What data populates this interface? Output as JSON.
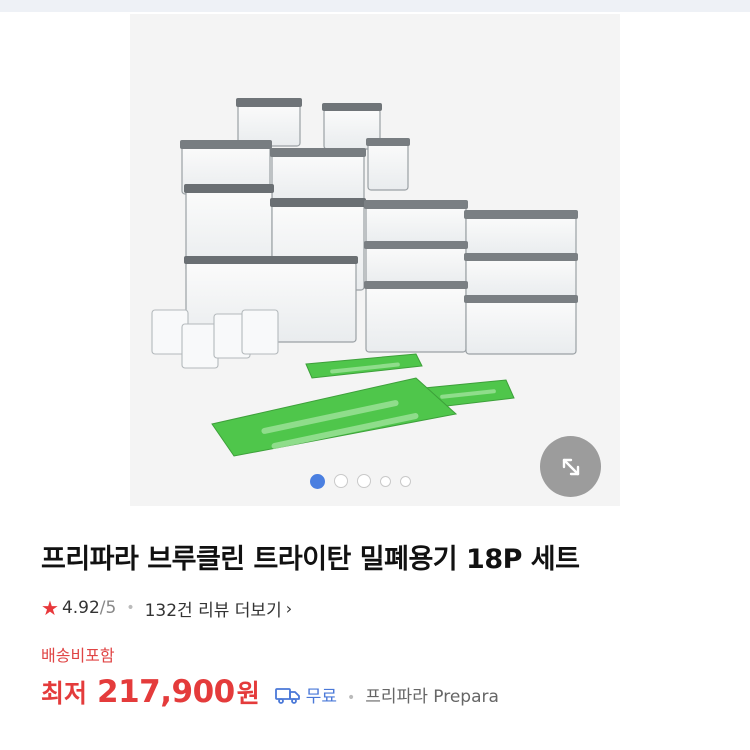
{
  "gallery": {
    "image_alt": "product-photo",
    "dots_total": 5,
    "active_index": 0,
    "expand_icon": "expand-icon"
  },
  "product": {
    "title": "프리파라 브루클린 트라이탄 밀폐용기 18P 세트",
    "rating": {
      "star_icon": "star-icon",
      "score": "4.92",
      "max": "/5",
      "review_text": "132건 리뷰 더보기",
      "chevron": "›"
    },
    "shipping_label": "배송비포함",
    "price": {
      "prefix": "최저",
      "value": "217,900",
      "unit": "원",
      "delivery_icon": "truck-icon",
      "delivery_text": "무료",
      "seller": "프리파라 Prepara"
    }
  },
  "colors": {
    "accent_red": "#e43b3b",
    "link_blue": "#4a78d8",
    "active_dot": "#4a7fe0"
  }
}
